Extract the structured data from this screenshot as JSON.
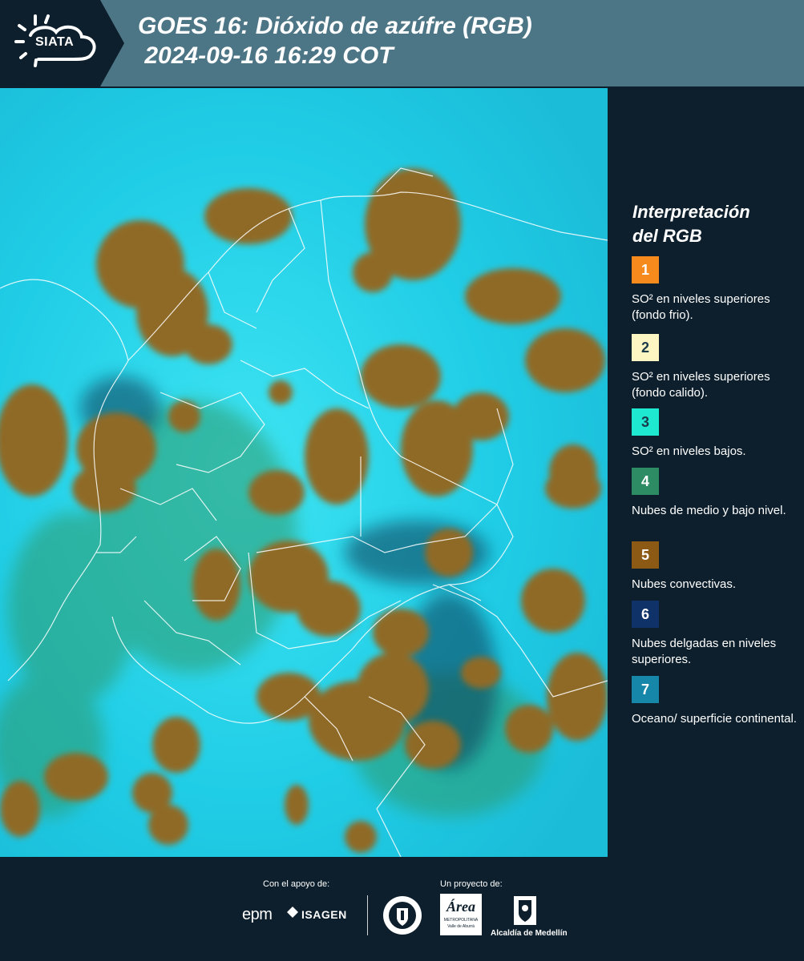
{
  "header": {
    "logo_text": "SIATA",
    "title_line1": "GOES 16: Dióxido de azúfre (RGB)",
    "title_line2": " 2024-09-16 16:29 COT"
  },
  "legend": {
    "title_line1": "Interpretación",
    "title_line2": "del RGB",
    "items": [
      {
        "number": "1",
        "color": "#f78a1c",
        "text": "SO² en niveles superiores (fondo frio)."
      },
      {
        "number": "2",
        "color": "#fdf6c3",
        "text": "SO² en niveles superiores (fondo calido)."
      },
      {
        "number": "3",
        "color": "#1ee8d0",
        "text": "SO² en niveles bajos."
      },
      {
        "number": "4",
        "color": "#2d8c63",
        "text": "Nubes de medio y bajo nivel."
      },
      {
        "number": "5",
        "color": "#8c5a14",
        "text": "Nubes convectivas."
      },
      {
        "number": "6",
        "color": "#0f3368",
        "text": "Nubes delgadas en niveles superiores."
      },
      {
        "number": "7",
        "color": "#1687a8",
        "text": "Oceano/ superficie continental."
      }
    ]
  },
  "footer": {
    "support_label": "Con el apoyo de:",
    "project_label": "Un proyecto de:",
    "sponsor_epm": "epm",
    "sponsor_isagen": "ISAGEN",
    "sponsor_area": "Área",
    "sponsor_area_sub1": "METROPOLITANA",
    "sponsor_area_sub2": "Valle de Aburrá",
    "sponsor_alcaldia": "Alcaldía de Medellín"
  }
}
